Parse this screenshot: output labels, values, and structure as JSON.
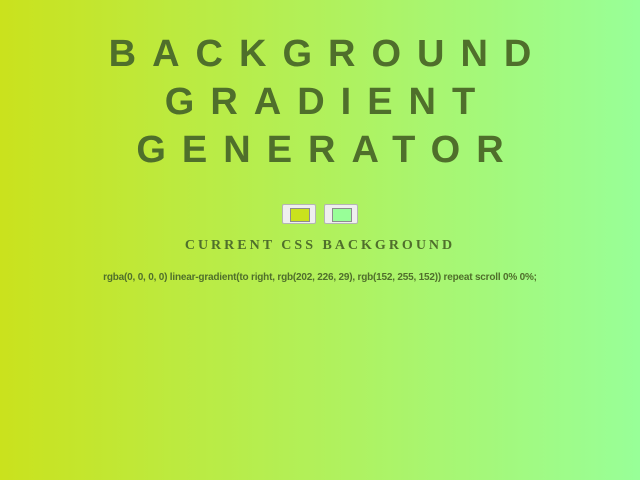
{
  "header": {
    "title_line1": "Background Gradient",
    "title_line2": "Generator"
  },
  "pickers": [
    {
      "name": "color-1",
      "value": "#cae21d"
    },
    {
      "name": "color-2",
      "value": "#98ff98"
    }
  ],
  "subtitle": "Current CSS Background",
  "css_value": "rgba(0, 0, 0, 0) linear-gradient(to right, rgb(202, 226, 29), rgb(152, 255, 152)) repeat scroll 0% 0%;",
  "colors": {
    "gradient_start": "#cae21d",
    "gradient_end": "#98ff98",
    "text": "#4f6f2b"
  }
}
